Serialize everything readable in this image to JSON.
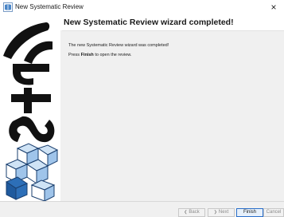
{
  "window": {
    "title": "New Systematic Review",
    "close_glyph": "×",
    "app_icon": "start-logo-icon"
  },
  "header": {
    "title": "New Systematic Review wizard completed!"
  },
  "sidebar": {
    "logo_text": "StArt"
  },
  "content": {
    "line1": "The new Systematic Review wizard was completed!",
    "line2_prefix": "Press",
    "line2_bold": "Finish",
    "line2_suffix": "to open the review."
  },
  "buttons": {
    "back": {
      "label": "Back",
      "arrow": "❮",
      "enabled": false
    },
    "next": {
      "label": "Next",
      "arrow": "❯",
      "enabled": false
    },
    "finish": {
      "label": "Finish",
      "enabled": true
    },
    "cancel": {
      "label": "Cancel",
      "enabled": false
    }
  },
  "colors": {
    "finish_border": "#2a6ec9",
    "cube_blue": "#2d6fb8",
    "cube_light": "#cfe3f5",
    "logo_black": "#111111"
  }
}
